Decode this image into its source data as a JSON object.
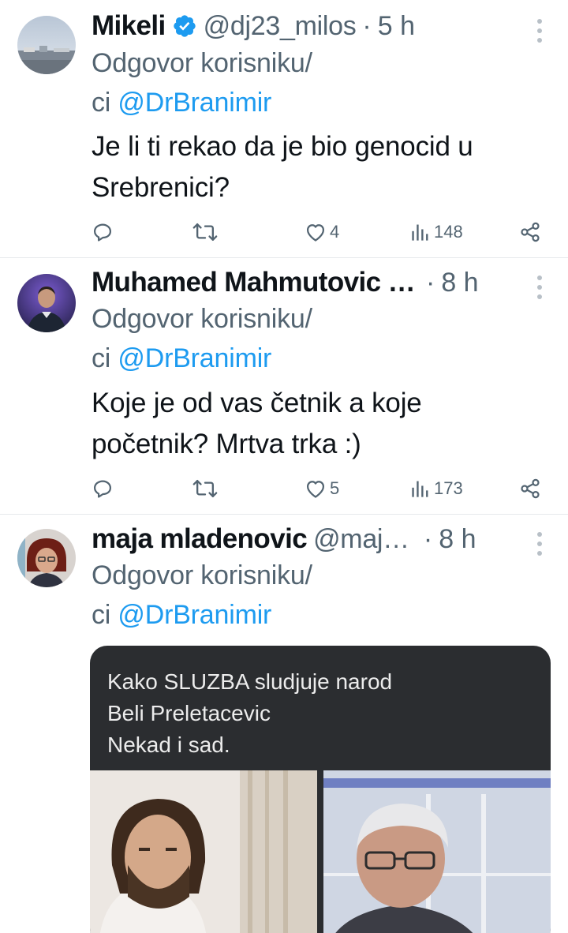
{
  "tweets": [
    {
      "name": "Mikeli",
      "verified": true,
      "handle": "@dj23_milos",
      "time": "5 h",
      "reply_prefix": "Odgovor korisniku/",
      "reply_prefix2": "ci ",
      "reply_to": "@DrBranimir",
      "text_lines": [
        "Je li ti rekao da je bio genocid u",
        "Srebrenici?"
      ],
      "likes": "4",
      "views": "148"
    },
    {
      "name": "Muhamed Mahmutovic …",
      "handle": "",
      "time": "8 h",
      "reply_prefix": "Odgovor korisniku/",
      "reply_prefix2": "ci ",
      "reply_to": "@DrBranimir",
      "text_lines": [
        "Koje je od vas četnik a koje",
        "početnik? Mrtva trka :)"
      ],
      "likes": "5",
      "views": "173"
    },
    {
      "name": "maja mladenovic",
      "handle": "@maj…",
      "time": "8 h",
      "reply_prefix": "Odgovor korisniku/",
      "reply_prefix2": "ci ",
      "reply_to": "@DrBranimir",
      "media_text_lines": [
        "Kako SLUZBA sludjuje narod",
        "Beli Preletacevic",
        "Nekad i sad."
      ]
    }
  ],
  "separator": "·",
  "icons": {
    "reply": "reply-icon",
    "retweet": "retweet-icon",
    "like": "heart-icon",
    "views": "views-icon",
    "share": "share-icon",
    "more": "more-icon",
    "verified": "verified-badge-icon"
  },
  "colors": {
    "link": "#1d9bf0",
    "secondary": "#536471",
    "verified": "#1d9bf0"
  }
}
